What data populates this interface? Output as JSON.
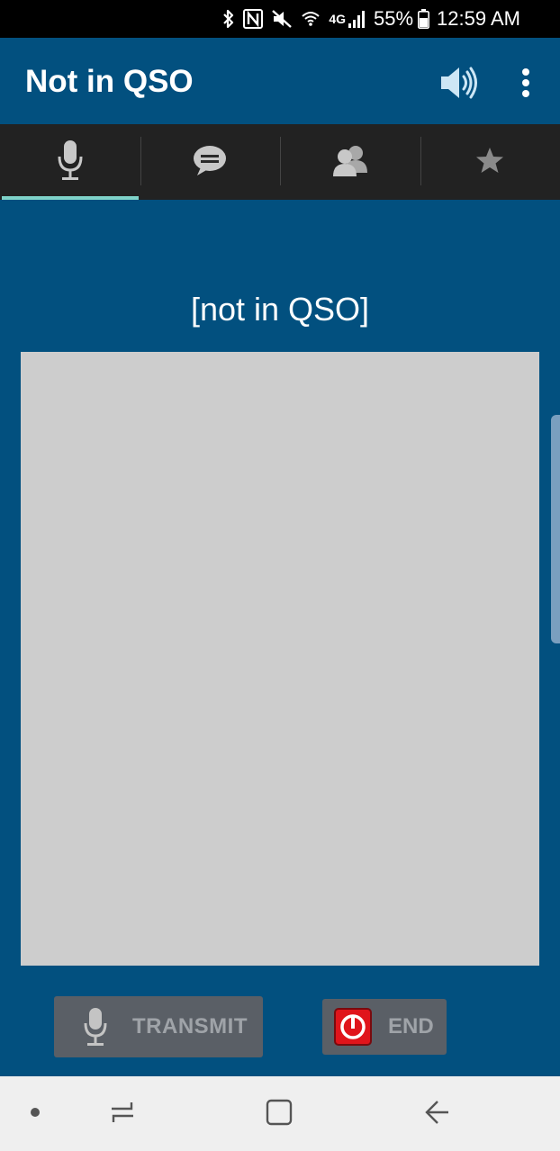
{
  "status_bar": {
    "icons": [
      "bluetooth-icon",
      "nfc-icon",
      "mute-icon",
      "wifi-icon",
      "4g-lte-icon",
      "signal-icon",
      "battery-icon"
    ],
    "network_label": "4G",
    "battery_percent": "55%",
    "time": "12:59 AM"
  },
  "app_bar": {
    "title": "Not in QSO",
    "actions": [
      "speaker-icon",
      "overflow-menu-icon"
    ]
  },
  "tabs": [
    {
      "icon": "microphone-icon",
      "active": true
    },
    {
      "icon": "chat-bubble-icon",
      "active": false
    },
    {
      "icon": "people-icon",
      "active": false
    },
    {
      "icon": "star-icon",
      "active": false
    }
  ],
  "main": {
    "qso_status": "[not in QSO]",
    "transmit_label": "TRANSMIT",
    "end_label": "END"
  },
  "colors": {
    "primary": "#02507f",
    "tab_bar": "#222222",
    "tab_indicator": "#7fd3c9",
    "panel": "#cdcdcd",
    "button": "#5a5f66",
    "end_icon": "#e0141b"
  },
  "nav_bar": {
    "items": [
      "home-dot-icon",
      "recents-icon",
      "home-icon",
      "back-icon"
    ]
  }
}
